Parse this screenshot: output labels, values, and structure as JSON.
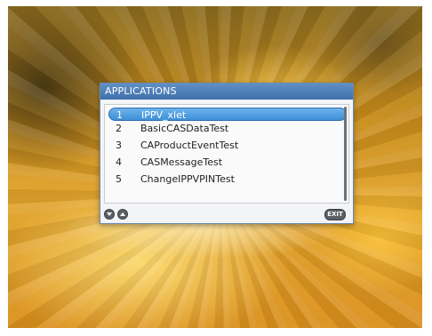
{
  "window": {
    "title": "APPLICATIONS",
    "exit_label": "EXIT"
  },
  "applications": [
    {
      "number": "1",
      "name": "IPPV_xlet",
      "selected": true
    },
    {
      "number": "2",
      "name": "BasicCASDataTest",
      "selected": false
    },
    {
      "number": "3",
      "name": "CAProductEventTest",
      "selected": false
    },
    {
      "number": "4",
      "name": "CASMessageTest",
      "selected": false
    },
    {
      "number": "5",
      "name": "ChangeIPPVPINTest",
      "selected": false
    }
  ],
  "colors": {
    "header": "#4a7db8",
    "selection": "#4a9be0"
  },
  "icons": [
    "scroll-down-icon",
    "scroll-up-icon",
    "exit-button-icon"
  ]
}
